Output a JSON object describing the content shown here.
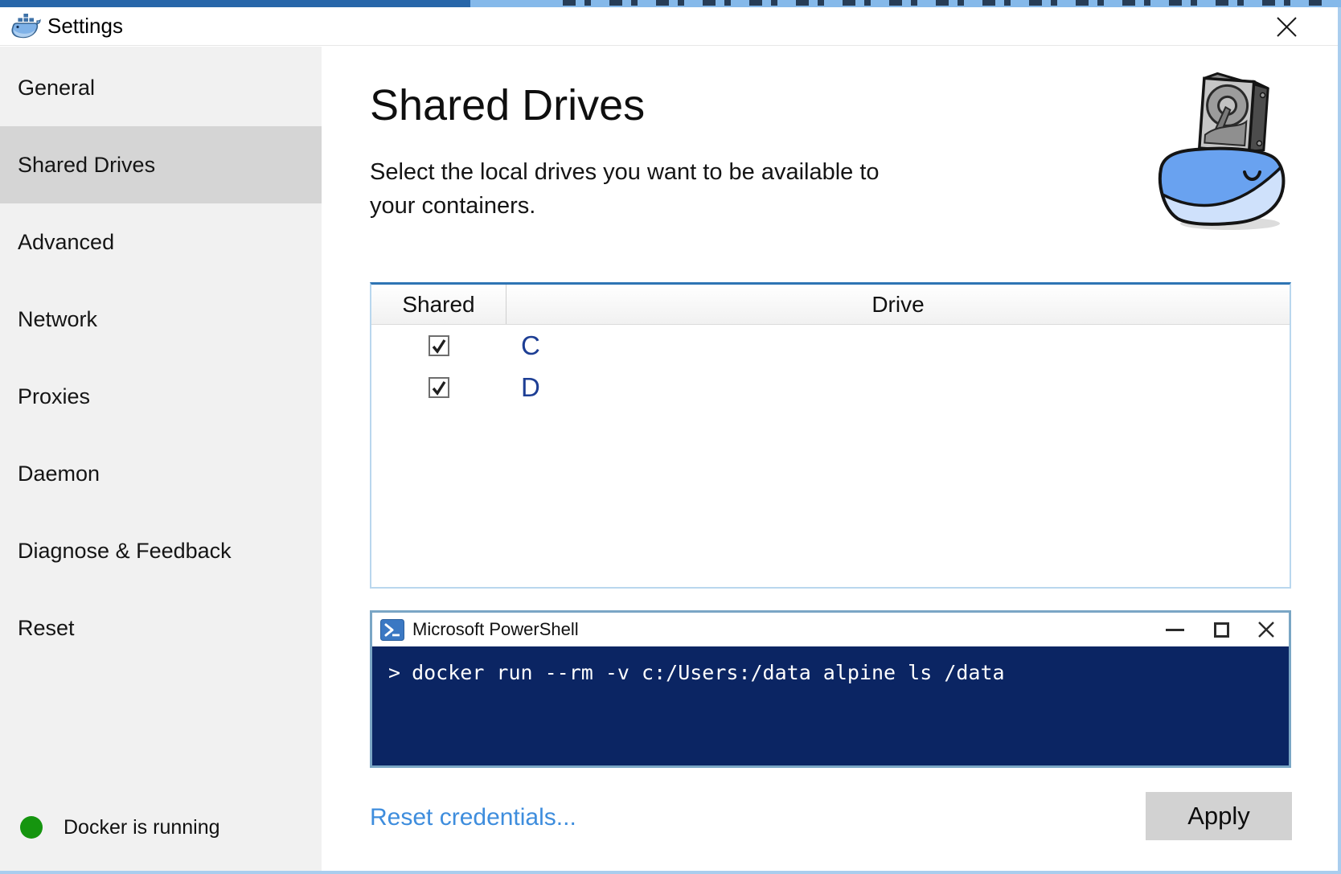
{
  "window": {
    "title": "Settings"
  },
  "sidebar": {
    "items": [
      {
        "label": "General",
        "selected": false
      },
      {
        "label": "Shared Drives",
        "selected": true
      },
      {
        "label": "Advanced",
        "selected": false
      },
      {
        "label": "Network",
        "selected": false
      },
      {
        "label": "Proxies",
        "selected": false
      },
      {
        "label": "Daemon",
        "selected": false
      },
      {
        "label": "Diagnose & Feedback",
        "selected": false
      },
      {
        "label": "Reset",
        "selected": false
      }
    ],
    "status": {
      "label": "Docker is running",
      "indicator_color": "#15950f"
    }
  },
  "main": {
    "heading": "Shared Drives",
    "description": "Select the local drives you want to be available to your containers.",
    "table": {
      "columns": [
        "Shared",
        "Drive"
      ],
      "rows": [
        {
          "shared": true,
          "drive": "C"
        },
        {
          "shared": true,
          "drive": "D"
        }
      ]
    },
    "powershell": {
      "title": "Microsoft PowerShell",
      "prompt": ">",
      "command": "docker run --rm -v c:/Users:/data alpine ls /data"
    },
    "footer": {
      "reset_credentials_label": "Reset credentials...",
      "apply_label": "Apply"
    }
  },
  "colors": {
    "drive_letter": "#1d3e94",
    "link_blue": "#3e8ddd",
    "terminal_background": "#0b2563",
    "status_green": "#15950f",
    "table_top_border": "#2e74b4",
    "selected_sidebar_bg": "#d5d5d5",
    "powershell_border": "#7aa6c5"
  }
}
